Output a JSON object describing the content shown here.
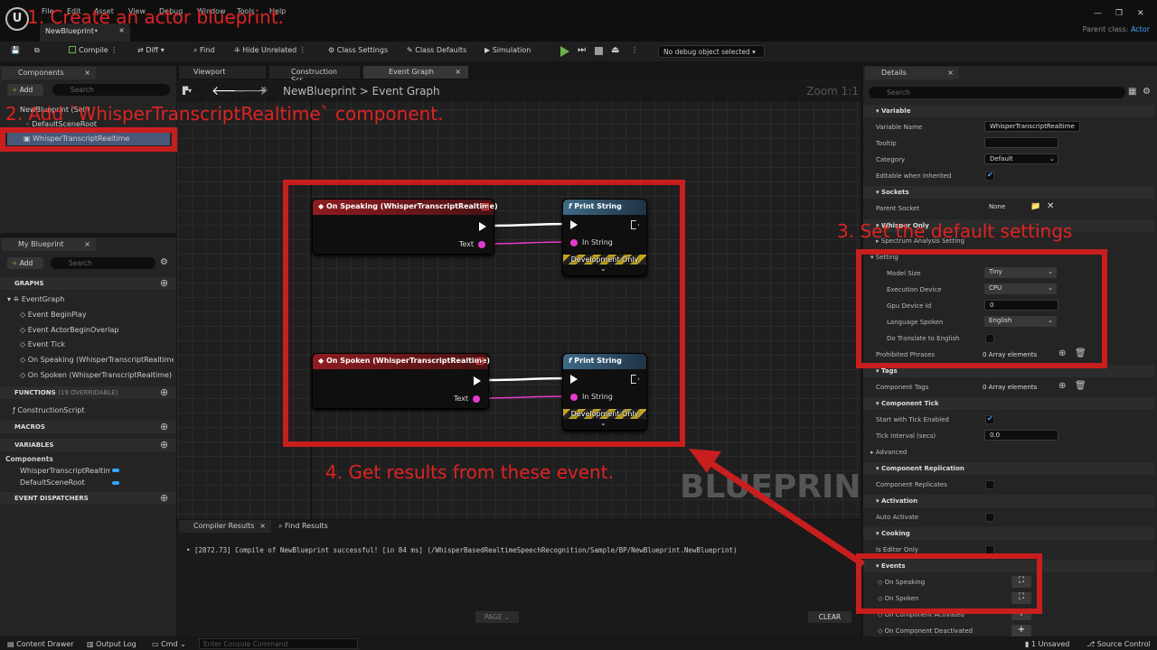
{
  "window": {
    "tab": "NewBlueprint•",
    "menu": [
      "File",
      "Edit",
      "Asset",
      "View",
      "Debug",
      "Window",
      "Tools",
      "Help"
    ],
    "parent_label": "Parent class:",
    "parent_value": "Actor"
  },
  "toolbar": {
    "compile": "Compile",
    "diff": "Diff",
    "find": "Find",
    "hide_unrelated": "Hide Unrelated",
    "class_settings": "Class Settings",
    "class_defaults": "Class Defaults",
    "simulation": "Simulation",
    "debug_object": "No debug object selected"
  },
  "components": {
    "tab": "Components",
    "add": "Add",
    "search": "Search",
    "root": "NewBlueprint (Self)",
    "items": [
      "DefaultSceneRoot",
      "WhisperTranscriptRealtime"
    ]
  },
  "myblueprint": {
    "tab": "My Blueprint",
    "add": "Add",
    "search": "Search",
    "graphs": "GRAPHS",
    "eventgraph": "EventGraph",
    "events": [
      "Event BeginPlay",
      "Event ActorBeginOverlap",
      "Event Tick",
      "On Speaking (WhisperTranscriptRealtime)",
      "On Spoken (WhisperTranscriptRealtime)"
    ],
    "functions": "FUNCTIONS",
    "functions_count": "(19 OVERRIDABLE)",
    "construction": "ConstructionScript",
    "macros": "MACROS",
    "variables": "VARIABLES",
    "components_cat": "Components",
    "vars": [
      "WhisperTranscriptRealtime",
      "DefaultSceneRoot"
    ],
    "dispatchers": "EVENT DISPATCHERS"
  },
  "editor_tabs": [
    "Viewport",
    "Construction Scr...",
    "Event Graph"
  ],
  "breadcrumb": {
    "root": "NewBlueprint",
    "sep": ">",
    "current": "Event Graph",
    "zoom": "Zoom 1:1"
  },
  "nodes": {
    "speaking": "On Speaking (WhisperTranscriptRealtime)",
    "spoken": "On Spoken (WhisperTranscriptRealtime)",
    "text": "Text",
    "print": "Print String",
    "in_string": "In String",
    "dev_only": "Development Only",
    "print_icon": "f"
  },
  "watermark": "BLUEPRINT",
  "compiler": {
    "tab1": "Compiler Results",
    "tab2": "Find Results",
    "log": "• [2872.73] Compile of NewBlueprint successful! [in 84 ms] (/WhisperBasedRealtimeSpeechRecognition/Sample/BP/NewBlueprint.NewBlueprint)",
    "page": "PAGE",
    "clear": "CLEAR"
  },
  "details": {
    "tab": "Details",
    "search": "Search",
    "variable": "Variable",
    "var_name_lbl": "Variable Name",
    "var_name": "WhisperTranscriptRealtime",
    "tooltip": "Tooltip",
    "category": "Category",
    "category_val": "Default",
    "editable": "Editable when Inherited",
    "sockets": "Sockets",
    "parent_socket": "Parent Socket",
    "none": "None",
    "whisper_only": "Whisper Only",
    "spectrum": "Spectrum Analysis Setting",
    "setting": "Setting",
    "model_size": "Model Size",
    "model_size_val": "Tiny",
    "exec_dev": "Execution Device",
    "exec_dev_val": "CPU",
    "gpu": "Gpu Device Id",
    "gpu_val": "0",
    "lang": "Language Spoken",
    "lang_val": "English",
    "translate": "Do Translate to English",
    "prohibited": "Prohibited Phrases",
    "array0": "0 Array elements",
    "tags": "Tags",
    "comp_tags": "Component Tags",
    "comp_tick": "Component Tick",
    "start_tick": "Start with Tick Enabled",
    "tick_int": "Tick Interval (secs)",
    "tick_val": "0.0",
    "advanced": "Advanced",
    "replication": "Component Replication",
    "comp_repl": "Component Replicates",
    "activation": "Activation",
    "auto_act": "Auto Activate",
    "cooking": "Cooking",
    "editor_only": "Is Editor Only",
    "events": "Events",
    "on_speaking": "On Speaking",
    "on_spoken": "On Spoken",
    "on_comp_act": "On Component Activated",
    "on_comp_deact": "On Component Deactivated"
  },
  "status": {
    "drawer": "Content Drawer",
    "output": "Output Log",
    "cmd": "Cmd",
    "console": "Enter Console Command",
    "unsaved": "1 Unsaved",
    "source": "Source Control"
  },
  "annotations": {
    "a1": "1. Create an actor blueprint.",
    "a2": "2. Add `WhisperTranscriptRealtime` component.",
    "a3": "3. Set the default settings",
    "a4": "4. Get results from these event."
  },
  "colors": {
    "annotation_red": "#c81e1e",
    "event_node": "#8e1c20",
    "function_node": "#3e6a88",
    "string_pin": "#e73ad0"
  }
}
